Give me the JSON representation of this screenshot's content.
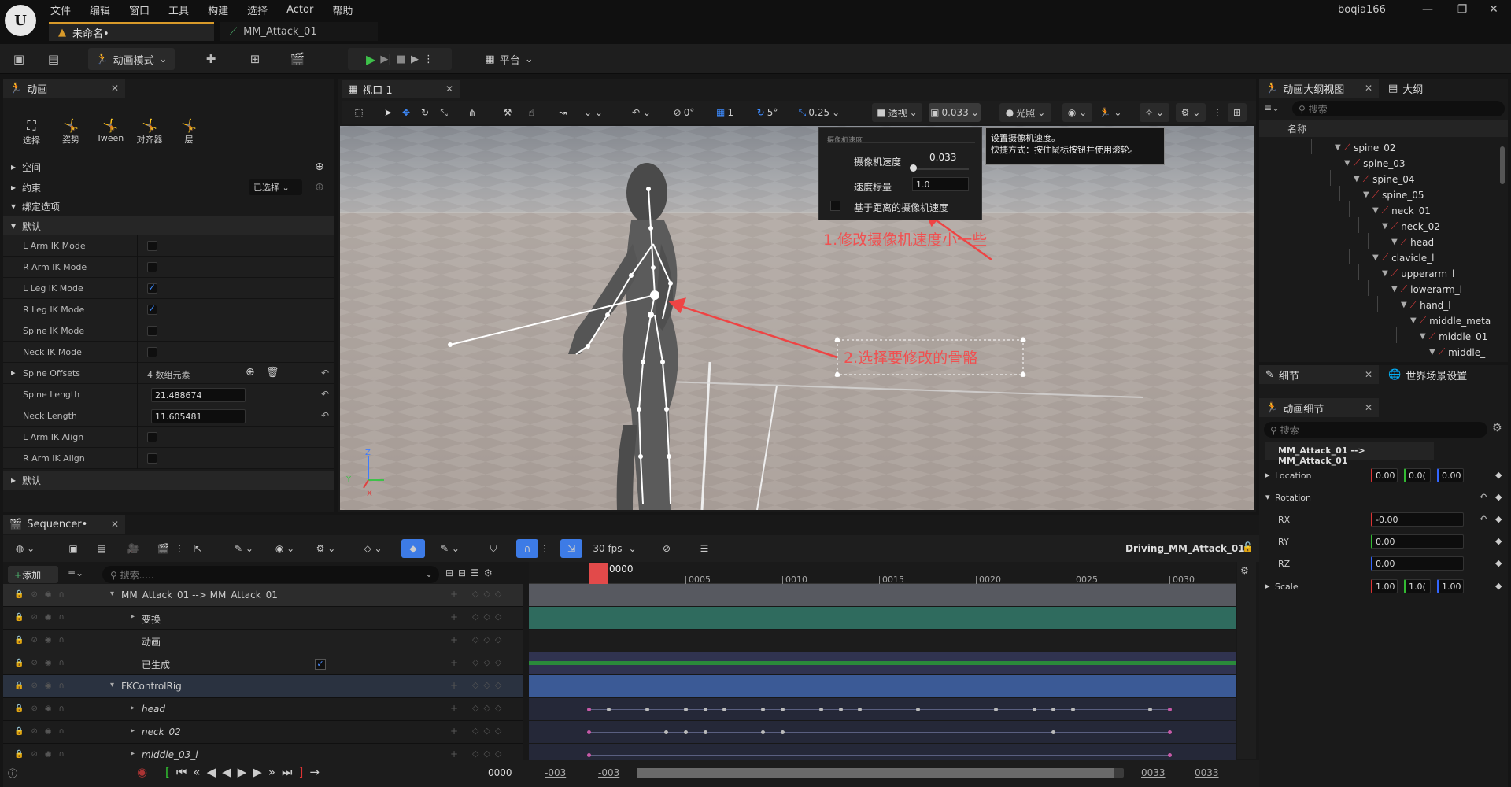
{
  "titlebar": {
    "menus": [
      "文件",
      "编辑",
      "窗口",
      "工具",
      "构建",
      "选择",
      "Actor",
      "帮助"
    ],
    "user": "boqia166",
    "tabs": [
      {
        "label": "未命名•"
      },
      {
        "label": "MM_Attack_01"
      }
    ]
  },
  "toolbar": {
    "mode_label": "动画模式",
    "platform_label": "平台"
  },
  "anim_panel": {
    "title": "动画",
    "modes": [
      {
        "label": "选择"
      },
      {
        "label": "姿势"
      },
      {
        "label": "Tween"
      },
      {
        "label": "对齐器"
      },
      {
        "label": "层"
      }
    ],
    "sections": {
      "space": "空间",
      "constraint": "约束",
      "constraint_value": "已选择",
      "binding": "绑定选项",
      "default": "默认",
      "default2": "默认"
    },
    "props": [
      {
        "label": "L Arm IK Mode",
        "type": "check",
        "checked": false
      },
      {
        "label": "R Arm IK Mode",
        "type": "check",
        "checked": false
      },
      {
        "label": "L Leg IK Mode",
        "type": "check",
        "checked": true
      },
      {
        "label": "R Leg IK Mode",
        "type": "check",
        "checked": true
      },
      {
        "label": "Spine IK Mode",
        "type": "check",
        "checked": false
      },
      {
        "label": "Neck IK Mode",
        "type": "check",
        "checked": false
      },
      {
        "label": "Spine Offsets",
        "type": "array",
        "value": "4 数组元素"
      },
      {
        "label": "Spine Length",
        "type": "number",
        "value": "21.488674"
      },
      {
        "label": "Neck Length",
        "type": "number",
        "value": "11.605481"
      },
      {
        "label": "L Arm IK Align",
        "type": "check",
        "checked": false
      },
      {
        "label": "R Arm IK Align",
        "type": "check",
        "checked": false
      }
    ]
  },
  "viewport": {
    "tab": "视口 1",
    "tools": {
      "rot_snap": "0°",
      "grid": "1",
      "angle": "5°",
      "scale": "0.25",
      "perspective": "透视",
      "cam_speed": "0.033",
      "lit": "光照"
    },
    "popup": {
      "header": "摄像机速度",
      "speed_label": "摄像机速度",
      "speed_value": "0.033",
      "speed_fraction": 0.02,
      "scalar_label": "速度标量",
      "scalar_value": "1.0",
      "distance_label": "基于距离的摄像机速度"
    },
    "tooltip": {
      "line1": "设置摄像机速度。",
      "line2": "快捷方式：按住鼠标按钮并使用滚轮。"
    },
    "annotations": {
      "a1": "1.修改摄像机速度小一些",
      "a2": "2.选择要修改的骨骼"
    },
    "axes": {
      "z": "Z",
      "y": "Y",
      "x": "X"
    }
  },
  "outliner": {
    "tab1": "动画大纲视图",
    "tab2": "大纲",
    "search_placeholder": "搜索",
    "column": "名称",
    "nodes": [
      {
        "name": "spine_02",
        "depth": 0
      },
      {
        "name": "spine_03",
        "depth": 1
      },
      {
        "name": "spine_04",
        "depth": 2
      },
      {
        "name": "spine_05",
        "depth": 3
      },
      {
        "name": "neck_01",
        "depth": 4
      },
      {
        "name": "neck_02",
        "depth": 5
      },
      {
        "name": "head",
        "depth": 6
      },
      {
        "name": "clavicle_l",
        "depth": 4
      },
      {
        "name": "upperarm_l",
        "depth": 5
      },
      {
        "name": "lowerarm_l",
        "depth": 6
      },
      {
        "name": "hand_l",
        "depth": 7
      },
      {
        "name": "middle_meta",
        "depth": 8
      },
      {
        "name": "middle_01",
        "depth": 9
      },
      {
        "name": "middle_",
        "depth": 10
      }
    ]
  },
  "details": {
    "tab1": "细节",
    "tab2": "世界场景设置",
    "anim_tab": "动画细节",
    "search_placeholder": "搜索",
    "binding": "MM_Attack_01 --> MM_Attack_01",
    "location": {
      "label": "Location",
      "x": "0.00",
      "y": "0.0(",
      "z": "0.00"
    },
    "rotation": {
      "label": "Rotation",
      "rx_label": "RX",
      "rx": "-0.00",
      "ry_label": "RY",
      "ry": "0.00",
      "rz_label": "RZ",
      "rz": "0.00"
    },
    "scale": {
      "label": "Scale",
      "x": "1.00",
      "y": "1.0(",
      "z": "1.00"
    }
  },
  "sequencer": {
    "title": "Sequencer•",
    "fps": "30 fps",
    "sequence_name": "Driving_MM_Attack_01•",
    "add_label": "添加",
    "search_placeholder": "搜索.....",
    "current_frame": "0000",
    "ticks": [
      "0005",
      "0010",
      "0015",
      "0020",
      "0025",
      "0030"
    ],
    "rows": [
      {
        "label": "MM_Attack_01 --> MM_Attack_01",
        "indent": 0
      },
      {
        "label": "变换",
        "indent": 1
      },
      {
        "label": "动画",
        "indent": 1
      },
      {
        "label": "已生成",
        "indent": 1
      },
      {
        "label": "FKControlRig",
        "indent": 0
      },
      {
        "label": "head",
        "indent": 1
      },
      {
        "label": "neck_02",
        "indent": 1
      },
      {
        "label": "middle_03_l",
        "indent": 1
      }
    ],
    "bottom": {
      "frame": "0000",
      "start1": "-003",
      "start2": "-003",
      "end1": "0033",
      "end2": "0033"
    }
  }
}
